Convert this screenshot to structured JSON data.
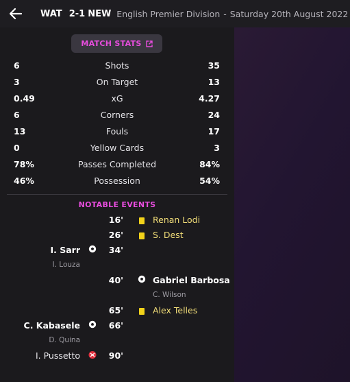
{
  "header": {
    "home_team": "WAT",
    "score": "2-1",
    "away_team": "NEW",
    "competition": "English Premier Division",
    "separator": "-",
    "date": "Saturday 20th August 2022"
  },
  "match_stats_button": "MATCH STATS",
  "stats": [
    {
      "home": "6",
      "label": "Shots",
      "away": "35"
    },
    {
      "home": "3",
      "label": "On Target",
      "away": "13"
    },
    {
      "home": "0.49",
      "label": "xG",
      "away": "4.27"
    },
    {
      "home": "6",
      "label": "Corners",
      "away": "24"
    },
    {
      "home": "13",
      "label": "Fouls",
      "away": "17"
    },
    {
      "home": "0",
      "label": "Yellow Cards",
      "away": "3"
    },
    {
      "home": "78%",
      "label": "Passes Completed",
      "away": "84%"
    },
    {
      "home": "46%",
      "label": "Possession",
      "away": "54%"
    }
  ],
  "notable_events_title": "NOTABLE EVENTS",
  "events": [
    {
      "minute": "16'",
      "side": "away",
      "type": "yellow-card",
      "player": "Renan Lodi"
    },
    {
      "minute": "26'",
      "side": "away",
      "type": "yellow-card",
      "player": "S. Dest"
    },
    {
      "minute": "34'",
      "side": "home",
      "type": "goal",
      "player": "I. Sarr",
      "assist": "I. Louza"
    },
    {
      "minute": "40'",
      "side": "away",
      "type": "goal",
      "player": "Gabriel Barbosa",
      "assist": "C. Wilson"
    },
    {
      "minute": "65'",
      "side": "away",
      "type": "yellow-card",
      "player": "Alex Telles"
    },
    {
      "minute": "66'",
      "side": "home",
      "type": "goal",
      "player": "C. Kabasele",
      "assist": "D. Quina"
    },
    {
      "minute": "90'",
      "side": "home",
      "type": "injury",
      "player": "I. Pussetto"
    }
  ],
  "colors": {
    "accent": "#e84dde",
    "yellow_card": "#f2d21a",
    "background": "#1b1a1d",
    "right_panel": "#2a1a34"
  },
  "icons": {
    "back": "arrow-left-icon",
    "popout": "popout-icon",
    "goal": "football-icon",
    "yellow_card": "yellow-card-icon",
    "injury": "injury-icon"
  }
}
